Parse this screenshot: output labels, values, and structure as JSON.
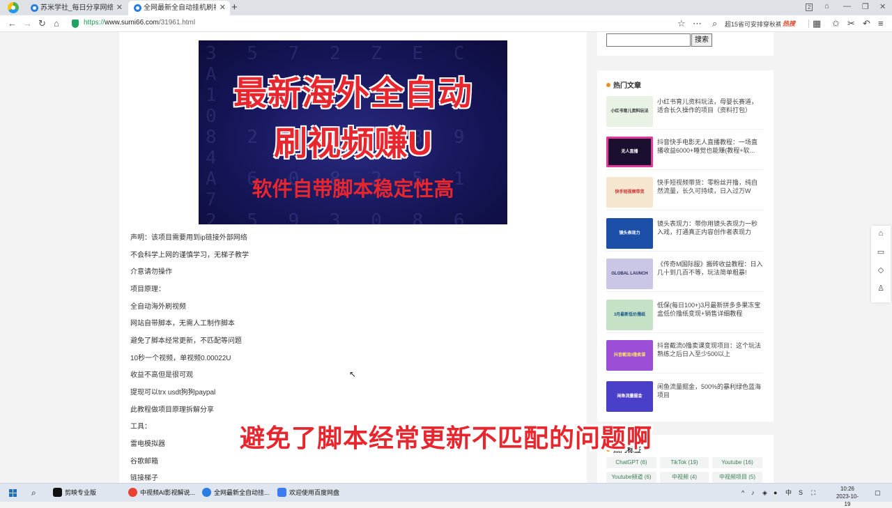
{
  "browser": {
    "tabs": [
      {
        "title": "苏米学社_每日分享网络赚钱",
        "active": false
      },
      {
        "title": "全网最新全自动挂机刷视频",
        "active": true
      }
    ],
    "new_tab": "+",
    "url_proto": "https://",
    "url_host": "www.sumi66.com",
    "url_path": "/31961.html",
    "search_text": "超15省可安排穿秋裤",
    "hot_label": "热搜",
    "badge_count": "2"
  },
  "article": {
    "banner": {
      "line1": "最新海外全自动",
      "line2": "刷视频赚U",
      "line3": "软件自带脚本稳定性高"
    },
    "lines": [
      "声明：该项目需要用到ip链接外部网络",
      "不会科学上网的谨慎学习，无梯子教学",
      "介意请勿操作",
      "项目原理：",
      "全自动海外刷视频",
      "网站自带脚本，无需人工制作脚本",
      "避免了脚本经常更新，不匹配等问题",
      "10秒一个视频，单视频0.00022U",
      "收益不高但是很可观",
      "提现可以trx usdt狗狗paypal",
      "此教程做项目原理拆解分享",
      "工具：",
      "雷电模拟器",
      "谷歌邮箱",
      "链接梯子"
    ]
  },
  "sidebar": {
    "search_button": "搜索",
    "hot_title": "热门文章",
    "hot_items": [
      {
        "text": "小红书育儿资料玩法，母婴长赛道，适合长久操作的项目（资料打包）",
        "thumb": "小红书育儿资料玩法",
        "color": "#e8f3e6"
      },
      {
        "text": "抖音快手电影无人直播教程：一场直播收益6000+睡觉也能赚(教程+软...",
        "thumb": "无人直播",
        "color": "#1a0f2e"
      },
      {
        "text": "快手短视频带货：零粉丝开撸，纯自然流量，长久可持续，日入过万W",
        "thumb": "快手短视频带货",
        "color": "#f5e6d0"
      },
      {
        "text": "镜头表现力：带你用镜头表现力一秒入戏，打通真正内容创作者表现力",
        "thumb": "镜头表现力",
        "color": "#1b4fa8"
      },
      {
        "text": "《传奇M国际服》搬砖收益教程：日入几十到几百不等，玩法简单粗暴!",
        "thumb": "GLOBAL LAUNCH",
        "color": "#c9c6e6"
      },
      {
        "text": "低保(每日100+)3月最新拼多多果冻宝盒低价撸纸变现+销售详细教程",
        "thumb": "3月最新低价撸纸",
        "color": "#c6e2c6"
      },
      {
        "text": "抖音截流0撸卖课变现项目：这个玩法熟练之后日入至少500以上",
        "thumb": "抖音截流0撸卖课",
        "color": "#9b4fd6"
      },
      {
        "text": "闲鱼流量掘金，500%的暴利绿色蓝海项目",
        "thumb": "闲鱼流量掘金",
        "color": "#4a3fc8"
      }
    ],
    "tags_title": "热门标签",
    "tags": [
      {
        "label": "ChatGPT (6)"
      },
      {
        "label": "TikTok (19)"
      },
      {
        "label": "Youtube (16)"
      },
      {
        "label": "Youtube频道 (6)"
      },
      {
        "label": "中视频 (4)"
      },
      {
        "label": "中视频项目 (5)"
      }
    ]
  },
  "overlay_subtitle": "避免了脚本经常更新不匹配的问题啊",
  "taskbar": {
    "apps": [
      {
        "label": "剪映专业版",
        "color": "#111111"
      },
      {
        "label": "中视频AI影视解说...",
        "color": "#e94235"
      },
      {
        "label": "全网最新全自动挂...",
        "color": "#2a7de1"
      },
      {
        "label": "欢迎使用百度网盘",
        "color": "#3b7cf4"
      }
    ],
    "ime": "中",
    "time": "10:26",
    "date": "2023-10-19"
  }
}
